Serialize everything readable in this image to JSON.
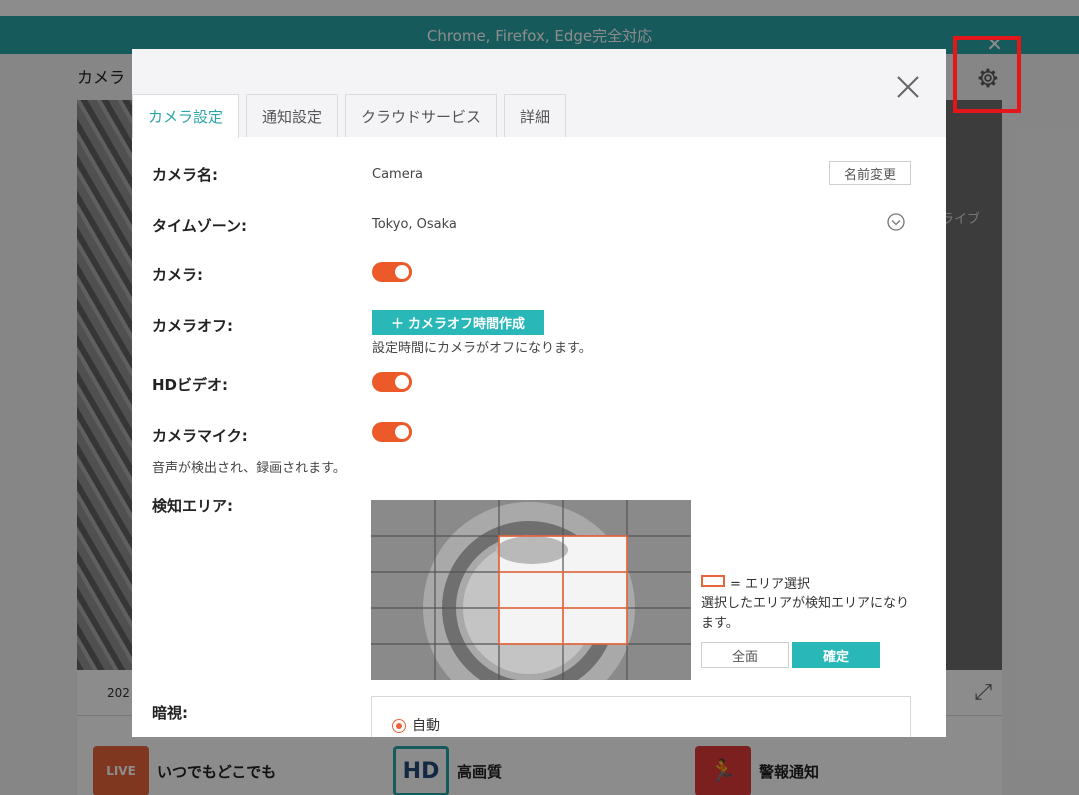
{
  "background": {
    "banner_text": "Chrome, Firefox, Edge完全対応",
    "banner_close": "✕",
    "page_title": "カメラ",
    "live_label": "ライブ",
    "date_prefix": "202",
    "features": [
      {
        "label": "いつでもどこでも",
        "icon_text": "LIVE",
        "icon": "phone-live-icon"
      },
      {
        "label": "高画質",
        "icon_text": "HD",
        "icon": "hd-icon"
      },
      {
        "label": "警報通知",
        "icon_text": "🏃",
        "icon": "alarm-notification-icon"
      }
    ],
    "gear_icon": "gear-icon"
  },
  "colors": {
    "accent": "#2aa5a7",
    "toggle_on": "#ec5a29",
    "highlight": "#e3161a",
    "area_border": "#e8643a"
  },
  "modal": {
    "tabs": [
      {
        "label": "カメラ設定",
        "active": true
      },
      {
        "label": "通知設定",
        "active": false
      },
      {
        "label": "クラウドサービス",
        "active": false
      },
      {
        "label": "詳細",
        "active": false
      }
    ],
    "camera_name": {
      "label": "カメラ名:",
      "value": "Camera",
      "rename_button": "名前変更"
    },
    "timezone": {
      "label": "タイムゾーン:",
      "value": "Tokyo, Osaka"
    },
    "camera": {
      "label": "カメラ:",
      "on": true
    },
    "camera_off": {
      "label": "カメラオフ:",
      "button": "カメラオフ時間作成",
      "hint": "設定時間にカメラがオフになります。"
    },
    "hd_video": {
      "label": "HDビデオ:",
      "on": true
    },
    "camera_mic": {
      "label": "カメラマイク:",
      "on": true,
      "hint": "音声が検出され、録画されます。"
    },
    "detection_area": {
      "label": "検知エリア:",
      "legend": "= エリア選択",
      "description": "選択したエリアが検知エリアになります。",
      "all_button": "全面",
      "confirm_button": "確定"
    },
    "night_vision": {
      "label": "暗視:",
      "option_selected": "自動"
    }
  }
}
